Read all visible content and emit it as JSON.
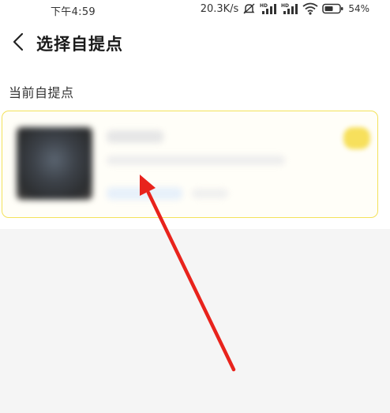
{
  "status_bar": {
    "time": "下午4:59",
    "network_speed": "20.3K/s",
    "battery_percent": "54%",
    "icons": [
      "mute-icon",
      "hd-signal-icon",
      "hd-signal-icon",
      "wifi-icon",
      "battery-icon"
    ]
  },
  "header": {
    "title": "选择自提点",
    "back_icon": "chevron-left-icon"
  },
  "section": {
    "label": "当前自提点"
  },
  "store_card": {
    "selected": true,
    "accent_color": "#f3e25a"
  },
  "annotation": {
    "arrow_color": "#e8231c"
  }
}
